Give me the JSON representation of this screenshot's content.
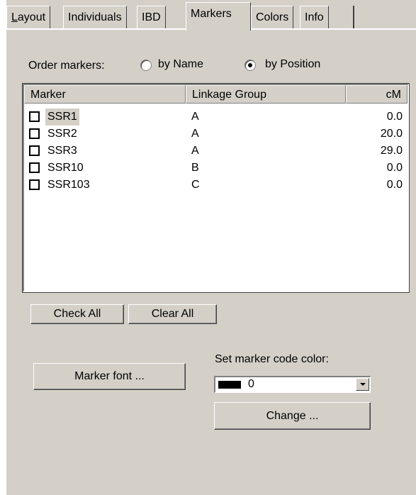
{
  "tabs": [
    {
      "label": "Layout"
    },
    {
      "label": "Individuals"
    },
    {
      "label": "IBD"
    },
    {
      "label": "Markers",
      "active": true
    },
    {
      "label": "Colors"
    },
    {
      "label": "Info"
    }
  ],
  "order": {
    "label": "Order markers:",
    "by_name": "by Name",
    "by_position": "by Position",
    "selected": "by Position"
  },
  "table": {
    "columns": [
      "Marker",
      "Linkage Group",
      "cM"
    ],
    "rows": [
      {
        "marker": "SSR1",
        "group": "A",
        "cm": "0.0",
        "checked": false,
        "selected": true
      },
      {
        "marker": "SSR2",
        "group": "A",
        "cm": "20.0",
        "checked": false
      },
      {
        "marker": "SSR3",
        "group": "A",
        "cm": "29.0",
        "checked": false
      },
      {
        "marker": "SSR10",
        "group": "B",
        "cm": "0.0",
        "checked": false
      },
      {
        "marker": "SSR103",
        "group": "C",
        "cm": "0.0",
        "checked": false
      }
    ]
  },
  "buttons": {
    "check_all": "Check All",
    "clear_all": "Clear All",
    "marker_font": "Marker font ...",
    "change": "Change ..."
  },
  "color": {
    "label": "Set marker code color:",
    "value": "0",
    "swatch": "#000000"
  }
}
